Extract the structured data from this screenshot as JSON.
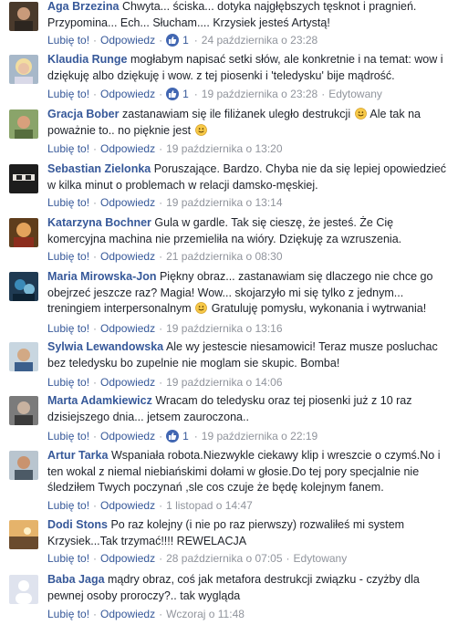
{
  "like_label": "Lubię to!",
  "reply_label": "Odpowiedz",
  "edited_label": "Edytowany",
  "colors": {
    "link": "#365899",
    "meta": "#90949c",
    "like_badge": "#4267b2"
  },
  "comments": [
    {
      "author": "Aga Brzezina",
      "text": "Chwyta... ściska... dotyka najgłębszych tęsknot i pragnień. Przypomina... Ech... Słucham.... Krzysiek jesteś Artystą!",
      "likes": "1",
      "date": "24 października o 23:28",
      "edited": false
    },
    {
      "author": "Klaudia Runge",
      "text": "mogłabym napisać setki słów, ale konkretnie i na temat: wow i dziękuję albo dziękuję i wow. z tej piosenki i 'teledysku' bije mądrość.",
      "likes": "1",
      "date": "19 października o 23:28",
      "edited": true
    },
    {
      "author": "Gracja Bober",
      "text": "zastanawiam się ile filiżanek uległo destrukcji",
      "text2": "Ale tak na poważnie to.. no pięknie jest",
      "likes": "",
      "date": "19 października o 13:20",
      "edited": false
    },
    {
      "author": "Sebastian Zielonka",
      "text": "Poruszające. Bardzo. Chyba nie da się lepiej opowiedzieć w kilka minut o problemach w relacji damsko-męskiej.",
      "likes": "",
      "date": "19 października o 13:14",
      "edited": false
    },
    {
      "author": "Katarzyna Bochner",
      "text": "Gula w gardle. Tak się cieszę, że jesteś. Że Cię komercyjna machina nie przemieliła na wióry. Dziękuję za wzruszenia.",
      "likes": "",
      "date": "21 października o 08:30",
      "edited": false
    },
    {
      "author": "Maria Mirowska-Jon",
      "text": "Piękny obraz... zastanawiam się dlaczego nie chce go obejrzeć jeszcze raz? Magia! Wow... skojarzyło mi się tylko z jednym... treningiem interpersonalnym",
      "text2": "Gratuluję pomysłu, wykonania i wytrwania!",
      "likes": "",
      "date": "19 października o 13:16",
      "edited": false
    },
    {
      "author": "Sylwia Lewandowska",
      "text": "Ale wy jestescie niesamowici! Teraz musze posluchac bez teledysku bo zupelnie nie moglam sie skupic. Bomba!",
      "likes": "",
      "date": "19 października o 14:06",
      "edited": false
    },
    {
      "author": "Marta Adamkiewicz",
      "text": "Wracam do teledysku oraz tej piosenki już z 10 raz dzisiejszego dnia... jetsem zauroczona..",
      "likes": "1",
      "date": "19 października o 22:19",
      "edited": false
    },
    {
      "author": "Artur Tarka",
      "text": "Wspaniała robota.Niezwykle ciekawy klip i wreszcie o czymś.No i ten wokal z niemal niebiańskimi dołami w głosie.Do tej pory specjalnie nie śledziłem Twych poczynań ,sle cos czuje że będę kolejnym fanem.",
      "likes": "",
      "date": "1 listopad o 14:47",
      "edited": false
    },
    {
      "author": "Dodi Stons",
      "text": "Po raz kolejny (i nie po raz pierwszy) rozwaliłeś mi system Krzysiek...Tak trzymać!!!! REWELACJA",
      "likes": "",
      "date": "28 października o 07:05",
      "edited": true
    },
    {
      "author": "Baba Jaga",
      "text": "mądry obraz, coś jak metafora destrukcji związku - czyżby dla pewnej osoby proroczy?.. tak wygląda",
      "likes": "",
      "date": "Wczoraj o 11:48",
      "edited": false
    }
  ]
}
